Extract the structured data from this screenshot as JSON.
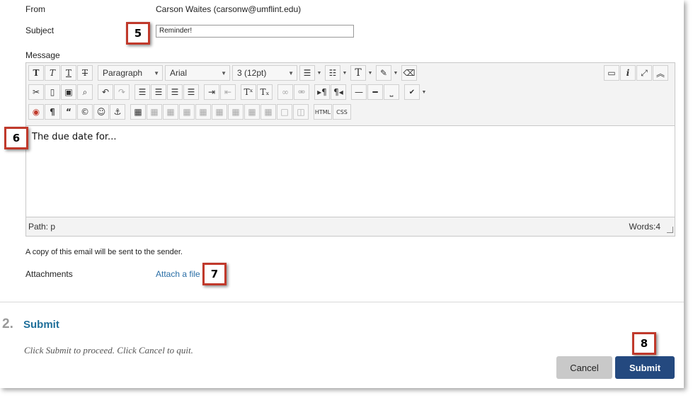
{
  "form": {
    "from_label": "From",
    "from_value": "Carson Waites (carsonw@umflint.edu)",
    "subject_label": "Subject",
    "subject_value": "Reminder!",
    "message_label": "Message",
    "copy_notice": "A copy of this email will be sent to the sender.",
    "attachments_label": "Attachments",
    "attach_link": "Attach a file"
  },
  "toolbar": {
    "paragraph": "Paragraph",
    "font": "Arial",
    "size": "3 (12pt)",
    "html_btn": "HTML",
    "css_btn": "CSS"
  },
  "editor": {
    "content": "The due date for...",
    "path": "Path: p",
    "words": "Words:4"
  },
  "section": {
    "number": "2.",
    "title": "Submit",
    "description": "Click Submit to proceed. Click Cancel to quit."
  },
  "buttons": {
    "cancel": "Cancel",
    "submit": "Submit"
  },
  "callouts": {
    "c5": "5",
    "c6": "6",
    "c7": "7",
    "c8": "8"
  },
  "colors": {
    "callout_border": "#c0392b",
    "submit_bg": "#24497f",
    "link": "#2a6ea6",
    "section_title": "#1f6f9a"
  }
}
